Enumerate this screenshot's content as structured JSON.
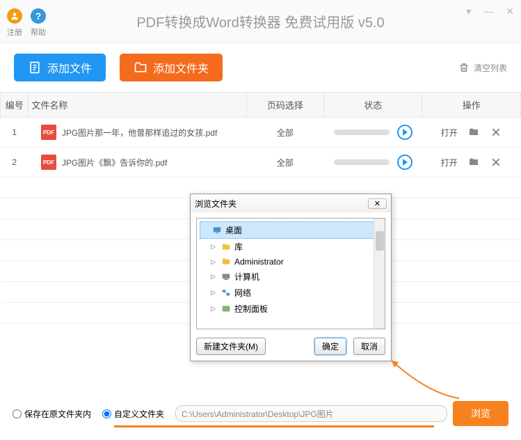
{
  "titlebar": {
    "register": "注册",
    "help": "帮助",
    "app_title": "PDF转换成Word转换器 免费试用版 v5.0"
  },
  "toolbar": {
    "add_file": "添加文件",
    "add_folder": "添加文件夹",
    "clear_list": "清空列表"
  },
  "table": {
    "headers": {
      "num": "编号",
      "name": "文件名称",
      "page": "页码选择",
      "status": "状态",
      "ops": "操作"
    },
    "rows": [
      {
        "num": "1",
        "badge": "PDF",
        "name": "JPG图片那一年，他曾那样追过的女孩.pdf",
        "page": "全部",
        "open": "打开"
      },
      {
        "num": "2",
        "badge": "PDF",
        "name": "JPG图片《飘》告诉你的.pdf",
        "page": "全部",
        "open": "打开"
      }
    ]
  },
  "dialog": {
    "title": "浏览文件夹",
    "close": "✕",
    "tree": [
      {
        "label": "桌面",
        "icon": "desktop",
        "selected": true,
        "expand": ""
      },
      {
        "label": "库",
        "icon": "library",
        "expand": "▷",
        "indent": 1
      },
      {
        "label": "Administrator",
        "icon": "user",
        "expand": "▷",
        "indent": 1
      },
      {
        "label": "计算机",
        "icon": "computer",
        "expand": "▷",
        "indent": 1
      },
      {
        "label": "网络",
        "icon": "network",
        "expand": "▷",
        "indent": 1
      },
      {
        "label": "控制面板",
        "icon": "control",
        "expand": "▷",
        "indent": 1
      }
    ],
    "new_folder": "新建文件夹(M)",
    "ok": "确定",
    "cancel": "取消"
  },
  "bottom": {
    "save_original": "保存在原文件夹内",
    "custom_folder": "自定义文件夹",
    "path": "C:\\Users\\Administrator\\Desktop\\JPG图片",
    "browse": "浏览"
  }
}
